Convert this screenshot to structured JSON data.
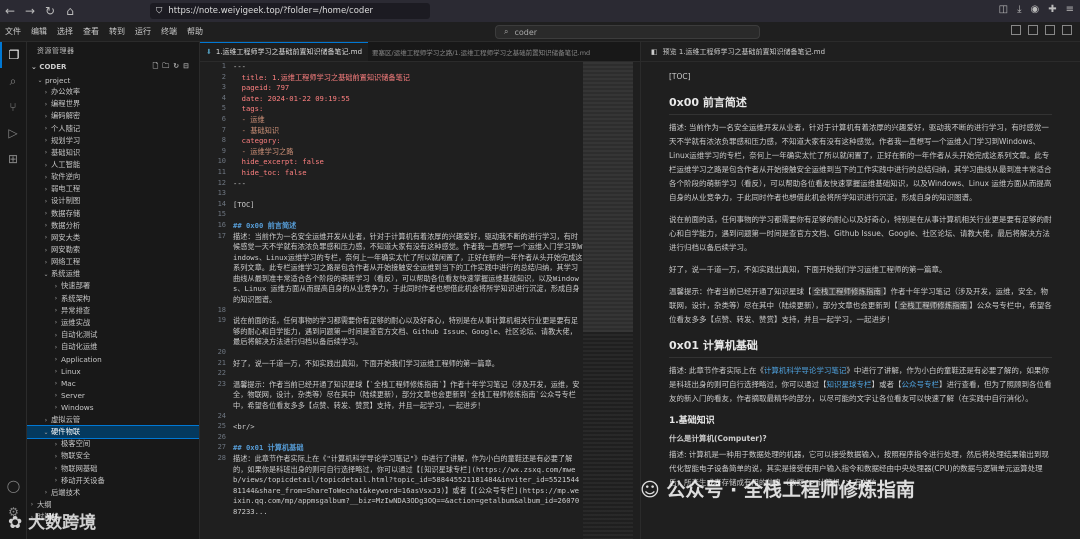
{
  "browser": {
    "url": "https://note.weiyigeek.top/?folder=/home/coder"
  },
  "menu": [
    "文件",
    "编辑",
    "选择",
    "查看",
    "转到",
    "运行",
    "终端",
    "帮助"
  ],
  "command_center": "coder",
  "sidebar": {
    "title": "资源管理器",
    "root": "CODER",
    "project": "project",
    "items": [
      {
        "label": "办公效率",
        "level": 2,
        "open": false
      },
      {
        "label": "编程世界",
        "level": 2,
        "open": false
      },
      {
        "label": "编码解密",
        "level": 2,
        "open": false
      },
      {
        "label": "个人随记",
        "level": 2,
        "open": false
      },
      {
        "label": "规划学习",
        "level": 2,
        "open": false
      },
      {
        "label": "基础知识",
        "level": 2,
        "open": false
      },
      {
        "label": "人工智能",
        "level": 2,
        "open": false
      },
      {
        "label": "软件逆向",
        "level": 2,
        "open": false
      },
      {
        "label": "弱电工程",
        "level": 2,
        "open": false
      },
      {
        "label": "设计制图",
        "level": 2,
        "open": false
      },
      {
        "label": "数据存储",
        "level": 2,
        "open": false
      },
      {
        "label": "数据分析",
        "level": 2,
        "open": false
      },
      {
        "label": "网安大类",
        "level": 2,
        "open": false
      },
      {
        "label": "网安勒索",
        "level": 2,
        "open": false
      },
      {
        "label": "网络工程",
        "level": 2,
        "open": false
      },
      {
        "label": "系统运维",
        "level": 2,
        "open": true
      },
      {
        "label": "快速部署",
        "level": 3,
        "open": false
      },
      {
        "label": "系统架构",
        "level": 3,
        "open": false
      },
      {
        "label": "异常排查",
        "level": 3,
        "open": false
      },
      {
        "label": "运维实战",
        "level": 3,
        "open": false
      },
      {
        "label": "自动化测试",
        "level": 3,
        "open": false
      },
      {
        "label": "自动化运维",
        "level": 3,
        "open": false
      },
      {
        "label": "Application",
        "level": 3,
        "open": false
      },
      {
        "label": "Linux",
        "level": 3,
        "open": false
      },
      {
        "label": "Mac",
        "level": 3,
        "open": false
      },
      {
        "label": "Server",
        "level": 3,
        "open": false
      },
      {
        "label": "Windows",
        "level": 3,
        "open": false
      },
      {
        "label": "虚拟云管",
        "level": 2,
        "open": false
      },
      {
        "label": "硬件物联",
        "level": 2,
        "open": true,
        "selected": true
      },
      {
        "label": "极客空间",
        "level": 3,
        "open": false
      },
      {
        "label": "物联安全",
        "level": 3,
        "open": false
      },
      {
        "label": "物联网基础",
        "level": 3,
        "open": false
      },
      {
        "label": "移动开关设备",
        "level": 3,
        "open": false
      },
      {
        "label": "后端技术",
        "level": 2,
        "open": false
      },
      {
        "label": "大纲",
        "level": 1,
        "open": false
      },
      {
        "label": "时间线",
        "level": 1,
        "open": false
      }
    ]
  },
  "editor": {
    "tab_title": "1.运维工程师学习之基础前置知识储备笔记.md",
    "tab_path": "要塞区/运维工程师学习之路/1.运维工程师学习之基础前置知识储备笔记.md",
    "line_numbers": [
      1,
      2,
      3,
      4,
      5,
      6,
      7,
      8,
      9,
      10,
      11,
      12,
      13,
      14,
      15,
      16,
      17,
      18,
      19,
      20,
      21,
      22,
      23,
      24,
      25,
      26,
      27,
      28,
      29,
      30,
      31,
      32,
      33,
      34,
      35,
      36,
      37,
      38,
      39,
      40,
      41,
      42,
      43,
      44
    ],
    "lines": [
      {
        "t": "---",
        "c": ""
      },
      {
        "t": "  title: 1.运维工程师学习之基础前置知识储备笔记",
        "c": "k"
      },
      {
        "t": "  pageid: 797",
        "c": "k"
      },
      {
        "t": "  date: 2024-01-22 09:19:55",
        "c": "k"
      },
      {
        "t": "  tags:",
        "c": "k"
      },
      {
        "t": "  - 运维",
        "c": "s"
      },
      {
        "t": "  - 基础知识",
        "c": "s"
      },
      {
        "t": "  category:",
        "c": "k"
      },
      {
        "t": "  - 运维学习之路",
        "c": "s"
      },
      {
        "t": "  hide_excerpt: false",
        "c": "k"
      },
      {
        "t": "  hide_toc: false",
        "c": "k"
      },
      {
        "t": "---",
        "c": ""
      },
      {
        "t": "",
        "c": ""
      },
      {
        "t": "[TOC]",
        "c": ""
      },
      {
        "t": "",
        "c": ""
      },
      {
        "t": "## 0x00 前言简述",
        "c": "h"
      },
      {
        "t": "描述：当前作为一名安全运维开发从业者，针对于计算机有着浓厚的兴趣爱好，驱动我不断的进行学习，有时候感觉一天不学就有浓浓负罪感和压力感，不知道大家有没有这种感觉。作者我一直想写一个运维入门学习到Windows、Linux运维学习的专栏，奈何上一年确实太忙了所以就闲置了，正好在新的一年作者从头开始完成这系列文章。此专栏运维学习之路是包含作者从开始接触安全运维到当下的工作实践中进行的总结归纳，其学习曲线从最到准丰常适合各个阶段的萌新学习（看反），可以帮助各位看友快速掌握运维基础知识，以及Windows、Linux 运维方面从而提高自身的从业竞争力，于此同时作者也想借此机会将所学知识进行沉淀，形成自身的知识图谱。",
        "c": "wrap"
      },
      {
        "t": "",
        "c": ""
      },
      {
        "t": "说在前面的话，任何事物的学习都需要你有足够的耐心以及好奇心，特别是在从事计算机相关行业更是要有足够的耐心和自学能力，遇到问题第一时间是查官方文档、Github Issue、Google、社区论坛、请教大佬，最后将解决方法进行归档以备后续学习。",
        "c": "wrap"
      },
      {
        "t": "",
        "c": ""
      },
      {
        "t": "好了，说一千道一万，不如实践出真知，下面开始我们学习运维工程师的第一篇章。",
        "c": "wrap"
      },
      {
        "t": "",
        "c": ""
      },
      {
        "t": "温馨提示：作者当前已经开通了知识星球【`全栈工程师修炼指南`】作者十年学习笔记（涉及开发，运维，安全，物联网，设计，杂类等）尽在其中（陆续更新），部分文章也会更新到`全栈工程师修炼指南`公众号专栏中，希望各位看友多多【点赞、转发、赞赏】支持，并且一起学习，一起进步！",
        "c": "wrap"
      },
      {
        "t": "",
        "c": ""
      },
      {
        "t": "<br/>",
        "c": ""
      },
      {
        "t": "",
        "c": ""
      },
      {
        "t": "## 0x01 计算机基础",
        "c": "h"
      },
      {
        "t": "描述：此章节作者实际上在《\"计算机科学导论学习笔记\"》中进行了讲解，作为小白的童鞋还是有必要了解的，如果你是科班出身的则可自行选择略过，你可以通过【[知识星球专栏](https://wx.zsxq.com/mweb/views/topicdetail/topicdetail.html?topic_id=588445521181484&inviter_id=552154481144&share_from=ShareToWechat&keyword=16asVsxJ3)】或者【[公众号专栏](https://mp.weixin.qq.com/mp/appmsgalbum?__biz=MzIwNDA3ODg3OQ==&action=getalbum&album_id=2607087233...",
        "c": "wrap"
      }
    ]
  },
  "preview": {
    "tab_title": "预览 1.运维工程师学习之基础前置知识储备笔记.md",
    "toc": "[TOC]",
    "h0": "0x00 前言简述",
    "p1": "描述: 当前作为一名安全运维开发从业者，针对于计算机有着浓厚的兴趣爱好，驱动我不断的进行学习，有时感觉一天不学就有浓浓负罪感和压力感，不知道大家有没有这种感觉。作者我一直想写一个运维入门学习到Windows、Linux运维学习的专栏，奈何上一年确实太忙了所以就闲置了，正好在新的一年作者从头开始完成这系列文章。此专栏运维学习之路是包含作者从开始接触安全运维到当下的工作实践中进行的总结归纳，其学习曲线从最到准丰常适合各个阶段的萌新学习（看反），可以帮助各位看友快速掌握运维基础知识，以及Windows、Linux 运维方面从而提高自身的从业竞争力，于此同时作者也想借此机会将所学知识进行沉淀，形成自身的知识图谱。",
    "p2": "说在前面的话，任何事物的学习都需要你有足够的耐心以及好奇心，特别是在从事计算机相关行业更是要有足够的耐心和自学能力，遇到问题第一时间是查官方文档、Github Issue、Google、社区论坛、请教大佬，最后将解决方法进行归档以备后续学习。",
    "p3": "好了，说一千道一万，不如实践出真知，下面开始我们学习运维工程师的第一篇章。",
    "p4_a": "温馨提示：作者当前已经开通了知识星球【",
    "p4_h1": "全栈工程师修炼指南",
    "p4_b": "】作者十年学习笔记（涉及开发，运维，安全，物联网，设计，杂类等）尽在其中（陆续更新），部分文章也会更新到【",
    "p4_h2": "全栈工程师修炼指南",
    "p4_c": "】公众号专栏中，希望各位看友多多【点赞、转发、赞赏】支持，并且一起学习，一起进步！",
    "h1": "0x01 计算机基础",
    "p5_a": "描述: 此章节作者实际上在《",
    "p5_l1": "计算机科学导论学习笔记",
    "p5_b": "》中进行了讲解，作为小白的童鞋还是有必要了解的，如果你是科班出身的则可自行选择略过，你可以通过【",
    "p5_l2": "知识星球专栏",
    "p5_c": "】或者【",
    "p5_l3": "公众号专栏",
    "p5_d": "】进行查看，但为了照顾到各位看友的新入门的看友，作者摘取最精华的部分，以尽可能的文字让各位看友可以快速了解（在实践中自行消化）。",
    "h2": "1.基础知识",
    "h3": "什么是计算机(Computer)?",
    "p6": "描述: 计算机是一种用于数据处理的机器，它可以接受数据输入，按照程序指令进行处理，然后将处理结果输出到现代化智能电子设备简单的说，其实是接受使用户输入指令和数据经由中央处理器(CPU)的数据与逻辑单元运算处理后，所产生或者存储成有用的信息（数据 -> 计算机 -> 有效信"
  },
  "watermark": "公众号 · 全栈工程师修炼指南",
  "logo": "大数跨境"
}
